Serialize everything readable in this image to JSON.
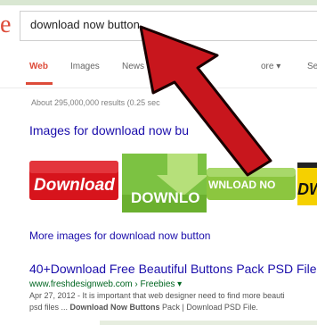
{
  "logo_letter": "e",
  "search": {
    "query": "download now button"
  },
  "tabs": [
    {
      "label": "Web"
    },
    {
      "label": "Images"
    },
    {
      "label": "News"
    },
    {
      "label": "ore ▾"
    },
    {
      "label": "Se"
    }
  ],
  "result_stats": "About 295,000,000 results (0.25 sec",
  "images_heading": "Images for download now bu",
  "thumbnails": [
    {
      "text": "Download",
      "bg": "#d7141c"
    },
    {
      "text": "DOWNLO",
      "bg": "#7cc242"
    },
    {
      "text": "WNLOAD NO",
      "bg": "#8cc63f"
    },
    {
      "text": "DW",
      "bg": "#f5d000"
    }
  ],
  "more_images": "More images for download now button",
  "result": {
    "title": "40+Download Free Beautiful Buttons Pack PSD File",
    "url": "www.freshdesignweb.com › Freebies ▾",
    "date": "Apr 27, 2012 - ",
    "snippet_a": "It is important that web designer need to find more beauti",
    "snippet_b": "psd files ... ",
    "snippet_bold_a": "Download Now Buttons",
    "snippet_c": " Pack | Download PSD File."
  },
  "colors": {
    "accent": "#dd4b39",
    "link": "#1a0dab",
    "url": "#006621",
    "arrow": "#c8161d"
  }
}
